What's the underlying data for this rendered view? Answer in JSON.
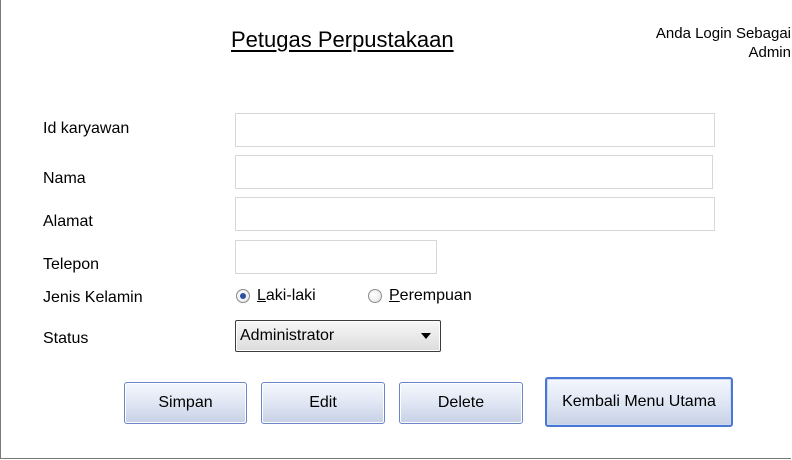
{
  "header": {
    "title": "Petugas Perpustakaan",
    "login_line1": "Anda Login Sebagai",
    "login_line2": "Admin"
  },
  "fields": {
    "id_karyawan": {
      "label": "Id karyawan",
      "value": ""
    },
    "nama": {
      "label": "Nama",
      "value": ""
    },
    "alamat": {
      "label": "Alamat",
      "value": ""
    },
    "telepon": {
      "label": "Telepon",
      "value": ""
    }
  },
  "gender": {
    "label": "Jenis Kelamin",
    "options": [
      {
        "mnemonic": "L",
        "rest": "aki-laki",
        "checked": true
      },
      {
        "mnemonic": "P",
        "rest": "erempuan",
        "checked": false
      }
    ]
  },
  "status": {
    "label": "Status",
    "selected": "Administrator"
  },
  "buttons": {
    "simpan": "Simpan",
    "edit": "Edit",
    "delete": "Delete",
    "kembali": "Kembali Menu Utama"
  },
  "colors": {
    "button_border": "#6a86c9",
    "default_button_border": "#4a77d4",
    "radio_dot": "#2b4fa3"
  }
}
